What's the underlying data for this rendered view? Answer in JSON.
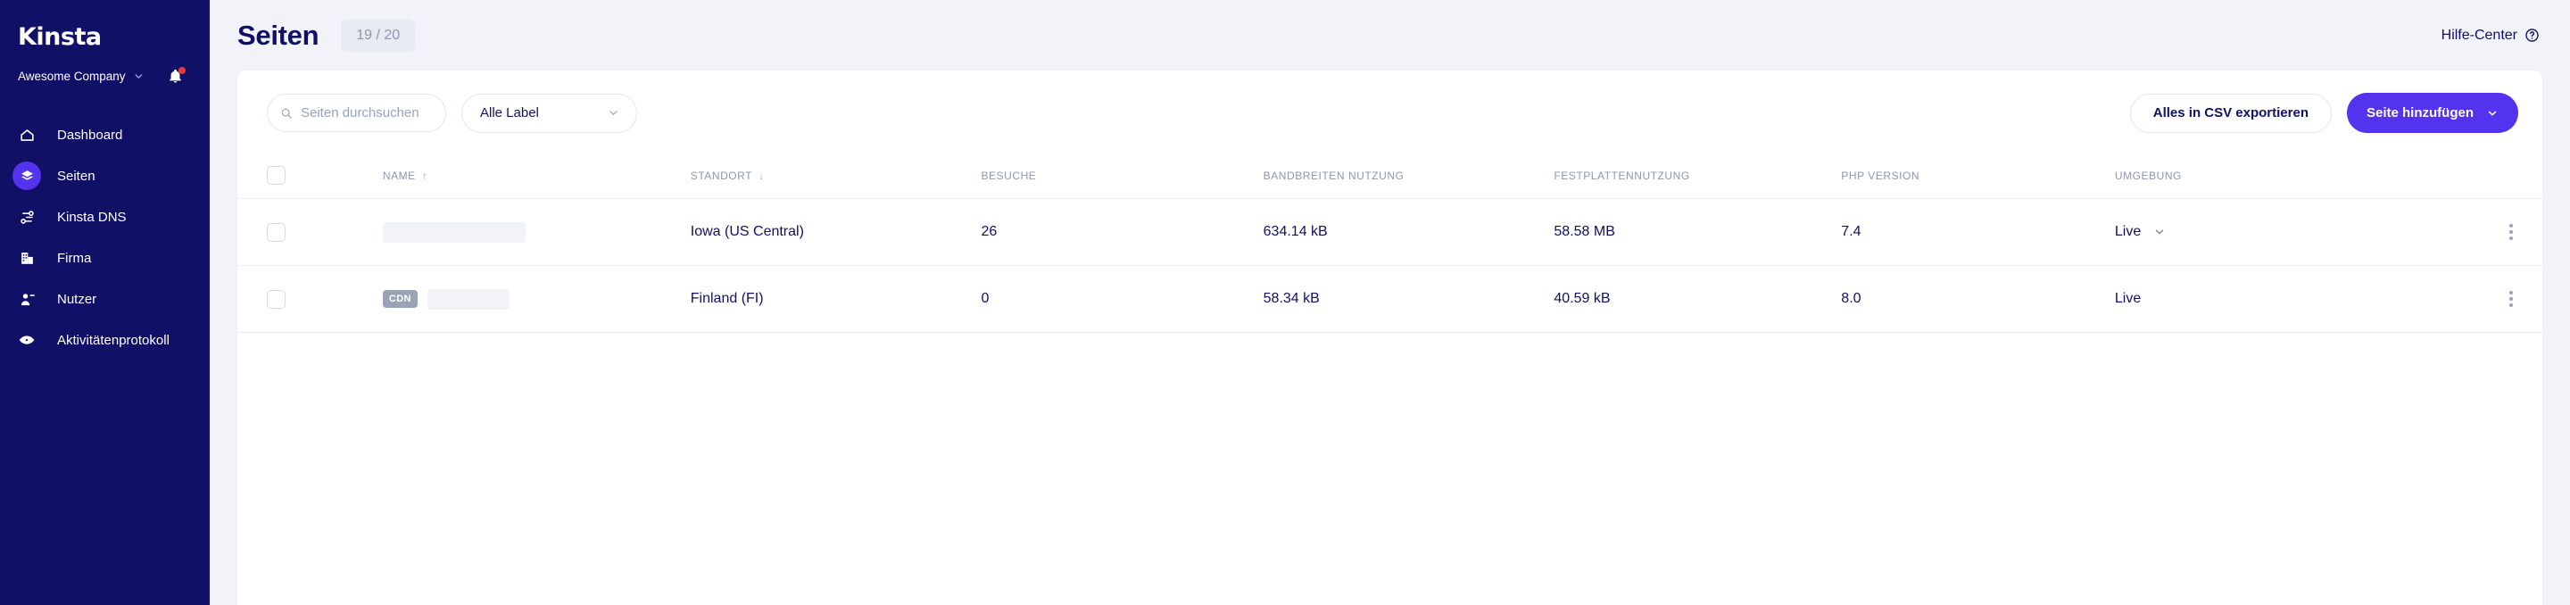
{
  "sidebar": {
    "logo_text": "Kinsta",
    "company": {
      "name": "Awesome Company",
      "caret_icon": "chevron-down-icon"
    },
    "notifications": {
      "icon": "bell-icon",
      "has_unread": true
    },
    "items": [
      {
        "label": "Dashboard",
        "icon": "home-icon",
        "active": false
      },
      {
        "label": "Seiten",
        "icon": "layers-icon",
        "active": true
      },
      {
        "label": "Kinsta DNS",
        "icon": "dns-network-icon",
        "active": false
      },
      {
        "label": "Firma",
        "icon": "building-icon",
        "active": false
      },
      {
        "label": "Nutzer",
        "icon": "user-minus-icon",
        "active": false
      },
      {
        "label": "Aktivitätenprotokoll",
        "icon": "eye-icon",
        "active": false
      }
    ]
  },
  "header": {
    "title": "Seiten",
    "count_badge": "19 / 20",
    "help": {
      "label": "Hilfe-Center",
      "icon": "question-circle-icon"
    }
  },
  "toolbar": {
    "search": {
      "value": "",
      "placeholder": "Seiten durchsuchen",
      "icon": "search-icon"
    },
    "label_filter": {
      "value": "Alle Label",
      "caret_icon": "chevron-down-icon"
    },
    "export_button": "Alles in CSV exportieren",
    "add_button": {
      "label": "Seite hinzufügen",
      "caret_icon": "chevron-down-icon"
    }
  },
  "table": {
    "select_all": {
      "checked": false
    },
    "columns": [
      {
        "key": "name",
        "label": "NAME",
        "sort": "↑"
      },
      {
        "key": "location",
        "label": "STANDORT",
        "sort": "↓"
      },
      {
        "key": "visits",
        "label": "BESUCHE",
        "sort": ""
      },
      {
        "key": "bandwidth",
        "label": "BANDBREITEN NUTZUNG",
        "sort": ""
      },
      {
        "key": "disk",
        "label": "FESTPLATTENNUTZUNG",
        "sort": ""
      },
      {
        "key": "php",
        "label": "PHP VERSION",
        "sort": ""
      },
      {
        "key": "environment",
        "label": "UMGEBUNG",
        "sort": ""
      }
    ],
    "rows": [
      {
        "checked": false,
        "cdn_badge": "",
        "name": "",
        "name_redacted": true,
        "location": "Iowa (US Central)",
        "visits": "26",
        "bandwidth": "634.14 kB",
        "disk": "58.58 MB",
        "php": "7.4",
        "environment": "Live",
        "environment_has_caret": true,
        "menu_icon": "kebab-menu-icon"
      },
      {
        "checked": false,
        "cdn_badge": "CDN",
        "name": "",
        "name_redacted": true,
        "location": "Finland (FI)",
        "visits": "0",
        "bandwidth": "58.34 kB",
        "disk": "40.59 kB",
        "php": "8.0",
        "environment": "Live",
        "environment_has_caret": false,
        "menu_icon": "kebab-menu-icon"
      }
    ]
  },
  "colors": {
    "sidebar_bg": "#101066",
    "page_bg": "#f1f3f8",
    "accent_purple": "#5333ed",
    "text_navy": "#101066",
    "muted": "#8e97ad",
    "notification_red": "#e23c35"
  }
}
